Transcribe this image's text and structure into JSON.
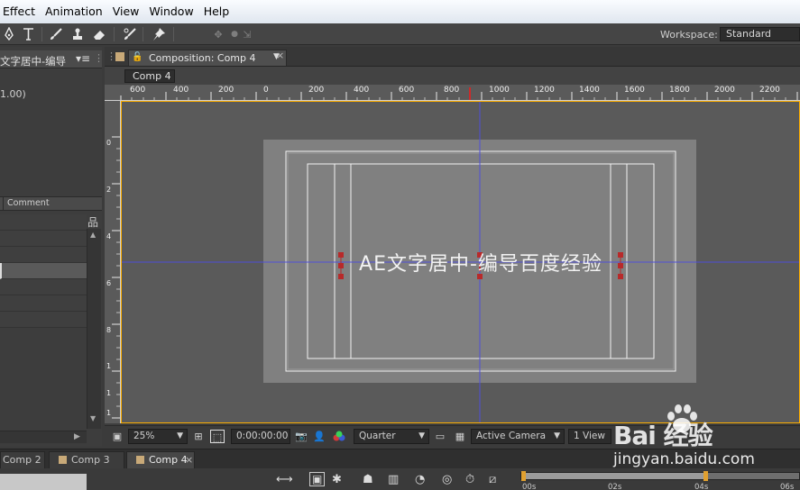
{
  "menubar": {
    "items": [
      {
        "label": "Effect"
      },
      {
        "label": "Animation"
      },
      {
        "label": "View"
      },
      {
        "label": "Window"
      },
      {
        "label": "Help"
      }
    ]
  },
  "toolbar": {
    "workspace_label": "Workspace:",
    "workspace_value": "Standard"
  },
  "left_panel": {
    "tab_label": "文字居中-编导",
    "info_text": "1.00)",
    "column_header": "Comment"
  },
  "composition": {
    "tab_label": "Composition: Comp 4",
    "close_glyph": "×",
    "subtab_label": "Comp 4",
    "canvas_text": "AE文字居中-编导百度经验",
    "ruler_h_labels": [
      "600",
      "400",
      "200",
      "0",
      "200",
      "400",
      "600",
      "800",
      "1000",
      "1200",
      "1400",
      "1600",
      "1800",
      "2000",
      "2200"
    ],
    "ruler_v_labels": [
      "0",
      "2",
      "4",
      "6",
      "8",
      "1",
      "1",
      "1"
    ]
  },
  "viewer_controls": {
    "zoom": "25%",
    "timecode": "0:00:00:00",
    "resolution": "Quarter",
    "camera": "Active Camera",
    "views": "1 View"
  },
  "bottom_tabs": [
    {
      "label": "Comp 2"
    },
    {
      "label": "Comp 3"
    },
    {
      "label": "Comp 4"
    }
  ],
  "timeline": {
    "marks": [
      "00s",
      "02s",
      "04s",
      "06s"
    ]
  },
  "watermark": {
    "brand": "Bai 经验",
    "url": "jingyan.baidu.com"
  },
  "colors": {
    "menubar_top": "#fafcff",
    "panel_bg": "#3d3d3d",
    "viewer_bg": "#5a5a5a",
    "comp_bg": "#808080",
    "guide_line": "#4f4fd8",
    "handle": "#b82a2a",
    "active_border": "#ffb000"
  }
}
